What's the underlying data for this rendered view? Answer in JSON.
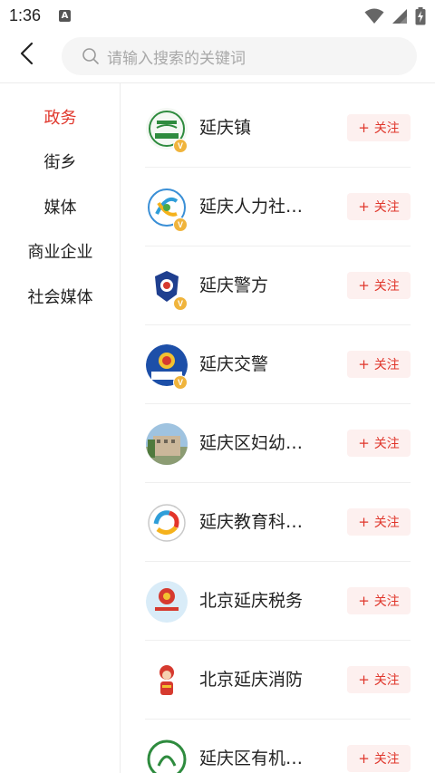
{
  "status_bar": {
    "time": "1:36",
    "notification_badge": "A",
    "icons": [
      "wifi-icon",
      "cellular-signal-icon",
      "battery-charging-icon"
    ]
  },
  "header": {
    "back_icon": "chevron-left-icon",
    "search": {
      "icon": "search-icon",
      "placeholder": "请输入搜索的关键词"
    }
  },
  "sidebar": {
    "active_index": 0,
    "items": [
      {
        "label": "政务"
      },
      {
        "label": "街乡"
      },
      {
        "label": "媒体"
      },
      {
        "label": "商业企业"
      },
      {
        "label": "社会媒体"
      }
    ]
  },
  "list": {
    "follow_label": "关注",
    "follow_icon": "plus-icon",
    "verified_badge": "V",
    "items": [
      {
        "name": "延庆镇",
        "verified": true
      },
      {
        "name": "延庆人力社…",
        "verified": true
      },
      {
        "name": "延庆警方",
        "verified": true
      },
      {
        "name": "延庆交警",
        "verified": true
      },
      {
        "name": "延庆区妇幼…",
        "verified": false
      },
      {
        "name": "延庆教育科…",
        "verified": false
      },
      {
        "name": "北京延庆税务",
        "verified": false
      },
      {
        "name": "北京延庆消防",
        "verified": false
      },
      {
        "name": "延庆区有机…",
        "verified": false
      }
    ]
  },
  "colors": {
    "accent": "#e0362b",
    "follow_bg": "#fdf0ef",
    "search_bg": "#f5f5f5",
    "verified_badge": "#f0b43c"
  }
}
